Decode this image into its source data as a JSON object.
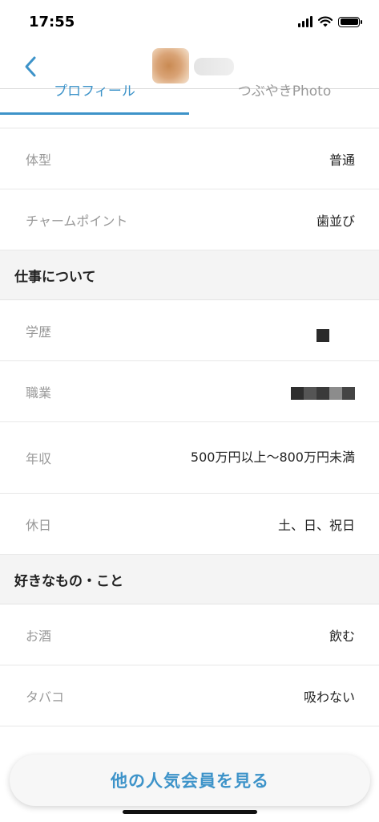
{
  "status_bar": {
    "time": "17:55"
  },
  "tabs": [
    {
      "label": "プロフィール",
      "active": true
    },
    {
      "label": "つぶやきPhoto",
      "active": false
    }
  ],
  "body_rows_top": [
    {
      "label": "体型",
      "value": "普通"
    },
    {
      "label": "チャームポイント",
      "value": "歯並び"
    }
  ],
  "section_work": {
    "title": "仕事について",
    "rows": [
      {
        "label": "学歴",
        "value": ""
      },
      {
        "label": "職業",
        "value": ""
      },
      {
        "label": "年収",
        "value": "500万円以上〜800万円未満"
      },
      {
        "label": "休日",
        "value": "土、日、祝日"
      }
    ]
  },
  "section_likes": {
    "title": "好きなもの・こと",
    "rows": [
      {
        "label": "お酒",
        "value": "飲む"
      },
      {
        "label": "タバコ",
        "value": "吸わない"
      }
    ]
  },
  "cta": {
    "label": "他の人気会員を見る"
  },
  "colors": {
    "accent": "#3d93c9",
    "section_bg": "#f4f4f4",
    "label_gray": "#999999"
  }
}
